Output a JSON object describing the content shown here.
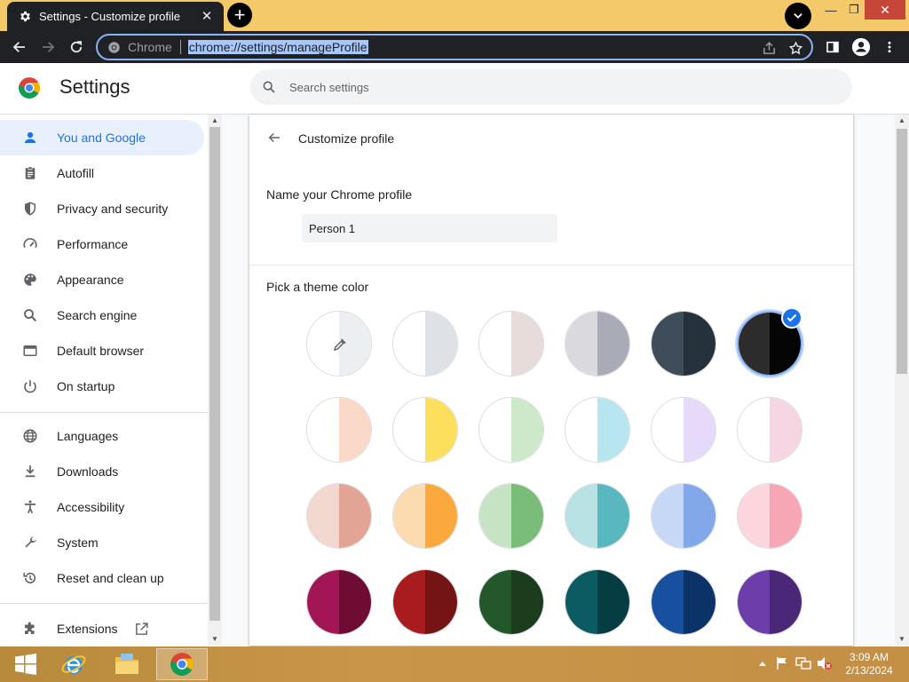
{
  "window": {
    "tab_title": "Settings - Customize profile",
    "tab_icon": "gear-icon",
    "new_tab_symbol": "+",
    "close_symbol": "✕",
    "minimize_symbol": "—",
    "maximize_symbol": "❐"
  },
  "toolbar": {
    "site_label": "Chrome",
    "url": "chrome://settings/manageProfile"
  },
  "header": {
    "title": "Settings",
    "search_placeholder": "Search settings"
  },
  "sidebar": {
    "items": [
      {
        "label": "You and Google",
        "icon": "person-icon",
        "active": true
      },
      {
        "label": "Autofill",
        "icon": "clipboard-icon"
      },
      {
        "label": "Privacy and security",
        "icon": "shield-icon"
      },
      {
        "label": "Performance",
        "icon": "speedometer-icon"
      },
      {
        "label": "Appearance",
        "icon": "palette-icon"
      },
      {
        "label": "Search engine",
        "icon": "search-icon"
      },
      {
        "label": "Default browser",
        "icon": "browser-window-icon"
      },
      {
        "label": "On startup",
        "icon": "power-icon"
      },
      {
        "label": "Languages",
        "icon": "globe-icon"
      },
      {
        "label": "Downloads",
        "icon": "download-icon"
      },
      {
        "label": "Accessibility",
        "icon": "accessibility-icon"
      },
      {
        "label": "System",
        "icon": "wrench-icon"
      },
      {
        "label": "Reset and clean up",
        "icon": "reset-icon"
      },
      {
        "label": "Extensions",
        "icon": "puzzle-icon"
      }
    ]
  },
  "main": {
    "page_title": "Customize profile",
    "name_label": "Name your Chrome profile",
    "name_value": "Person 1",
    "theme_label": "Pick a theme color",
    "selected_theme": "black",
    "themes": [
      {
        "name": "custom",
        "left": "#ffffff",
        "right": "#eceff1"
      },
      {
        "name": "default",
        "left": "#ffffff",
        "right": "#dee1e6"
      },
      {
        "name": "light-warm-grey",
        "left": "#ffffff",
        "right": "#e6dbd9"
      },
      {
        "name": "grey",
        "left": "#d9d9de",
        "right": "#a9acb6"
      },
      {
        "name": "dark-slate",
        "left": "#3f4d5a",
        "right": "#26323b"
      },
      {
        "name": "black",
        "left": "#2c2c2c",
        "right": "#050505"
      },
      {
        "name": "peach-light",
        "left": "#ffffff",
        "right": "#fbd9c8"
      },
      {
        "name": "yellow-light",
        "left": "#ffffff",
        "right": "#fddf5e"
      },
      {
        "name": "green-light",
        "left": "#ffffff",
        "right": "#cde9c9"
      },
      {
        "name": "cyan-light",
        "left": "#ffffff",
        "right": "#b7e6f0"
      },
      {
        "name": "lavender-light",
        "left": "#ffffff",
        "right": "#e6d9fa"
      },
      {
        "name": "pink-light",
        "left": "#ffffff",
        "right": "#f6d6e2"
      },
      {
        "name": "rose",
        "left": "#f2d7cf",
        "right": "#e2a595"
      },
      {
        "name": "orange",
        "left": "#fddbb0",
        "right": "#fba93d"
      },
      {
        "name": "green",
        "left": "#c6e4c4",
        "right": "#79bd78"
      },
      {
        "name": "teal",
        "left": "#b7e1e2",
        "right": "#58b7bf"
      },
      {
        "name": "blue",
        "left": "#c7d8f6",
        "right": "#82a8ea"
      },
      {
        "name": "pink",
        "left": "#fdd5dc",
        "right": "#f7a6b6"
      },
      {
        "name": "magenta-dark",
        "left": "#a21655",
        "right": "#6e0c34"
      },
      {
        "name": "red-dark",
        "left": "#a81b1e",
        "right": "#741414"
      },
      {
        "name": "green-dark",
        "left": "#22582a",
        "right": "#1b3d1d"
      },
      {
        "name": "teal-dark",
        "left": "#0a5b62",
        "right": "#063d42"
      },
      {
        "name": "blue-dark",
        "left": "#16509e",
        "right": "#0c3367"
      },
      {
        "name": "purple-dark",
        "left": "#6d3da9",
        "right": "#4a2777"
      }
    ]
  },
  "taskbar": {
    "time": "3:09 AM",
    "date": "2/13/2024"
  },
  "colors": {
    "accent": "#1a73e8",
    "tab_strip": "#f3c969",
    "toolbar": "#202124"
  }
}
